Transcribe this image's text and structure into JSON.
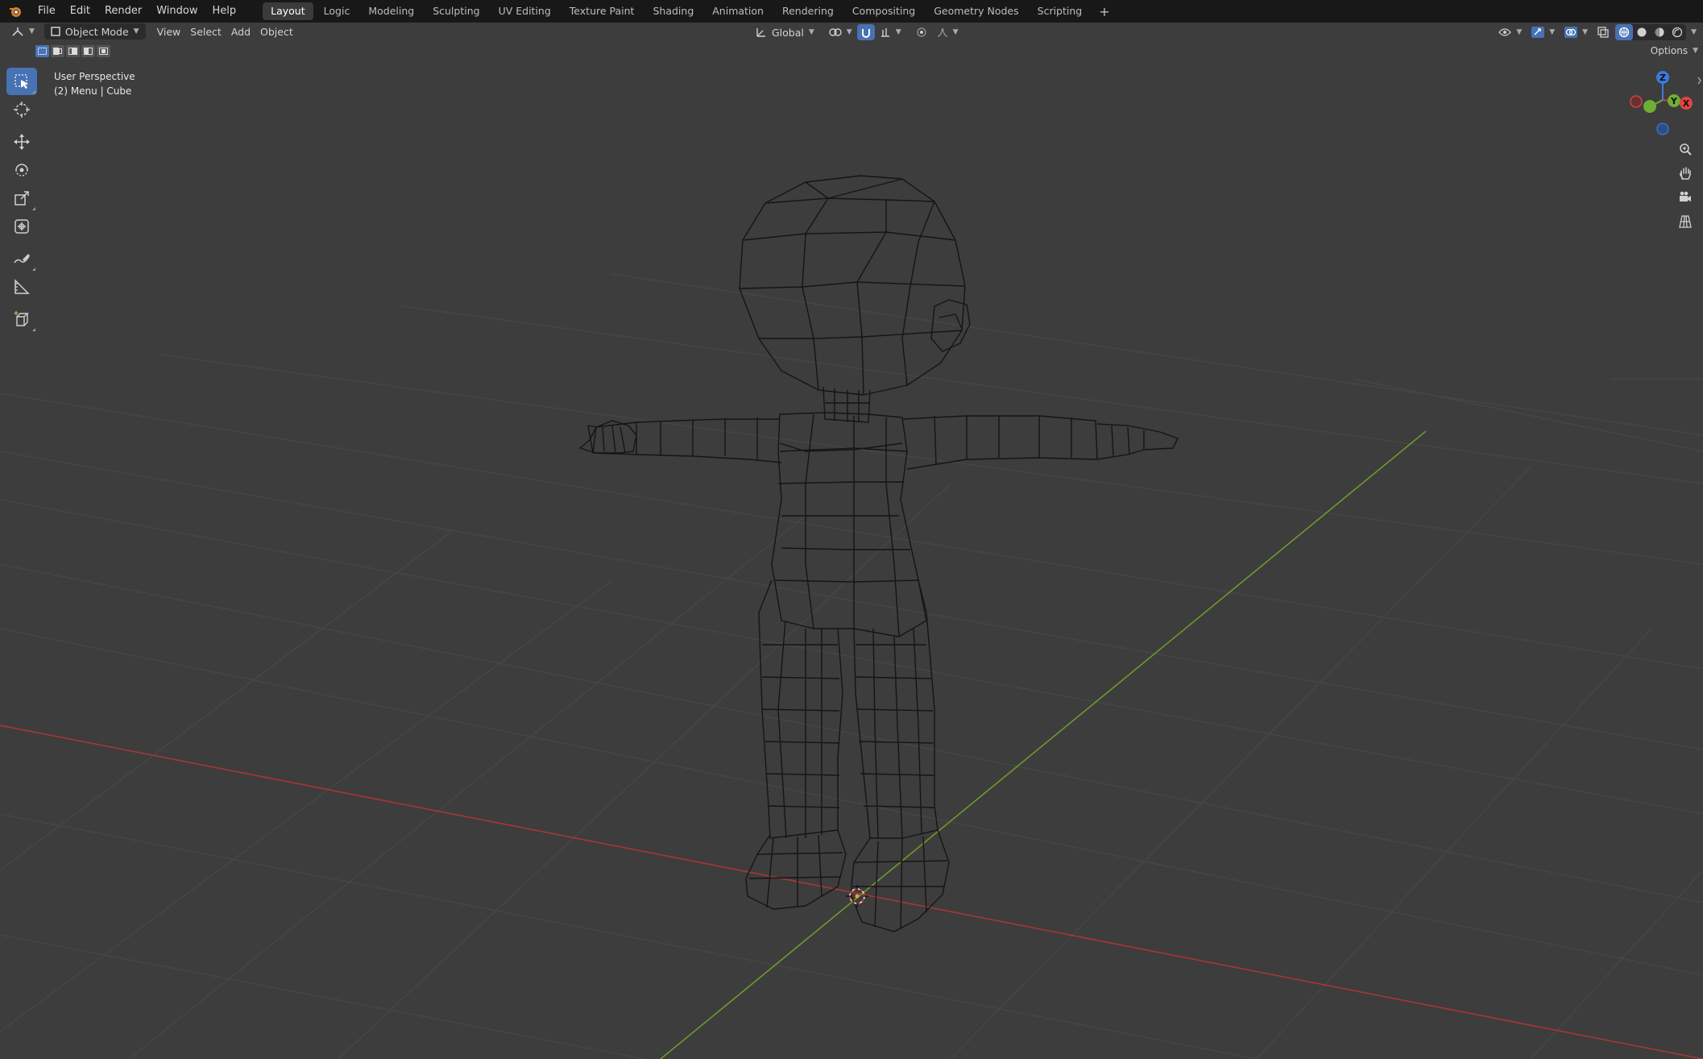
{
  "topbar": {
    "menus": [
      "File",
      "Edit",
      "Render",
      "Window",
      "Help"
    ],
    "workspaces": [
      "Layout",
      "Logic",
      "Modeling",
      "Sculpting",
      "UV Editing",
      "Texture Paint",
      "Shading",
      "Animation",
      "Rendering",
      "Compositing",
      "Geometry Nodes",
      "Scripting"
    ],
    "active_workspace": "Layout",
    "add_tab": "+"
  },
  "header": {
    "mode": "Object Mode",
    "menus": [
      "View",
      "Select",
      "Add",
      "Object"
    ],
    "orientation": "Global",
    "options_label": "Options"
  },
  "viewport": {
    "view_name": "User Perspective",
    "object_info": "(2) Menu | Cube"
  },
  "gizmo": {
    "z_label": "Z",
    "y_label": "Y",
    "x_label": "X"
  },
  "toolbar": {
    "tools": [
      "select-box",
      "cursor",
      "move",
      "rotate",
      "scale",
      "transform",
      "annotate",
      "measure",
      "add-cube"
    ],
    "active": "select-box"
  },
  "colors": {
    "accent": "#4772b3",
    "background": "#3d3d3d",
    "grid": "#474747",
    "x_axis": "#b03a3a",
    "y_axis": "#6e9b2c",
    "wire": "#111111"
  }
}
